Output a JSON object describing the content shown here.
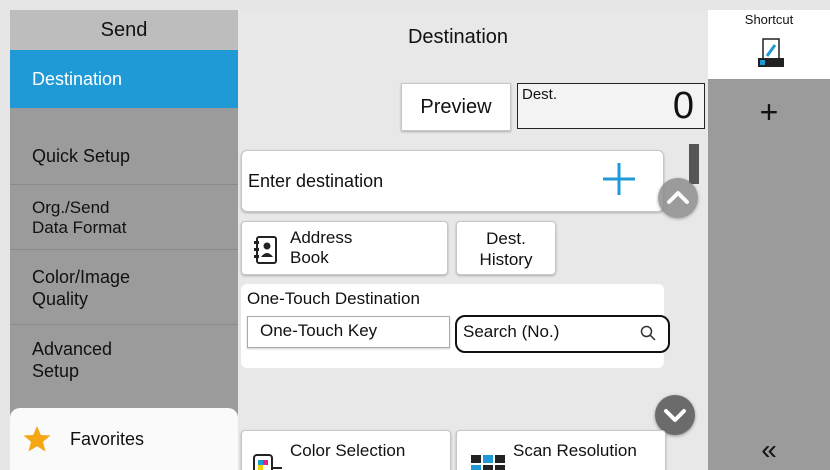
{
  "left_panel": {
    "title": "Send",
    "items": [
      {
        "label": "Destination",
        "active": true
      },
      {
        "label": "Quick Setup"
      },
      {
        "label_line1": "Org./Send",
        "label_line2": "Data Format"
      },
      {
        "label_line1": "Color/Image",
        "label_line2": "Quality"
      },
      {
        "label_line1": "Advanced",
        "label_line2": "Setup"
      }
    ],
    "favorites_label": "Favorites",
    "favorites_icon": "star-icon"
  },
  "center": {
    "title": "Destination",
    "preview_label": "Preview",
    "dest_label": "Dest.",
    "dest_count": "0",
    "enter_destination_label": "Enter destination",
    "address_book_line1": "Address",
    "address_book_line2": "Book",
    "dest_history_line1": "Dest.",
    "dest_history_line2": "History",
    "one_touch_title": "One-Touch Destination",
    "one_touch_key_label": "One-Touch Key",
    "search_no_label": "Search (No.)",
    "color_selection_label": "Color Selection",
    "scan_resolution_label": "Scan Resolution"
  },
  "right_panel": {
    "title": "Shortcut",
    "add_label": "+",
    "collapse_label": "«"
  },
  "colors": {
    "accent": "#1f9ad6",
    "panel_gray": "#9b9b9b",
    "background": "#e8e8e8"
  }
}
